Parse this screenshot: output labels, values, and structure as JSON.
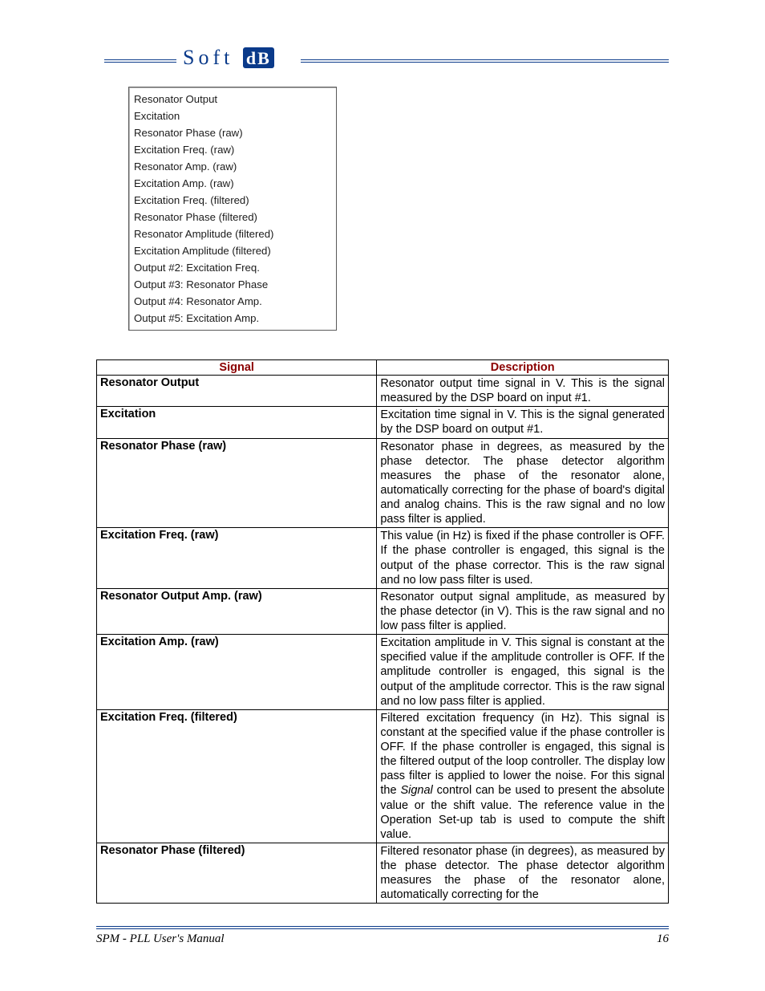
{
  "logo": {
    "left": "Soft",
    "right": "dB"
  },
  "listbox": [
    "Resonator Output",
    "Excitation",
    "Resonator Phase (raw)",
    "Excitation Freq. (raw)",
    "Resonator Amp. (raw)",
    "Excitation Amp. (raw)",
    "Excitation Freq. (filtered)",
    "Resonator Phase (filtered)",
    "Resonator Amplitude (filtered)",
    "Excitation Amplitude (filtered)",
    "Output #2: Excitation Freq.",
    "Output #3: Resonator Phase",
    "Output #4: Resonator Amp.",
    "Output #5: Excitation Amp."
  ],
  "table": {
    "headers": {
      "signal": "Signal",
      "description": "Description"
    },
    "rows": [
      {
        "signal": "Resonator Output",
        "desc": "Resonator output time signal in V. This is the signal measured by the DSP board on input #1."
      },
      {
        "signal": "Excitation",
        "desc": "Excitation time signal in V. This is the signal generated by the DSP board on output #1."
      },
      {
        "signal": "Resonator Phase (raw)",
        "desc": "Resonator phase in degrees, as measured by the phase detector. The phase detector algorithm measures the phase of the resonator alone, automatically correcting for the phase of board's digital and analog chains. This is the raw signal and no low pass filter is applied."
      },
      {
        "signal": "Excitation Freq. (raw)",
        "desc": "This value (in Hz) is fixed if the phase controller is OFF. If the phase controller is engaged, this signal is the output of the phase corrector. This is the raw signal and no low pass filter is used."
      },
      {
        "signal": "Resonator Output Amp. (raw)",
        "desc": "Resonator output signal amplitude, as measured by the phase detector (in V). This is the raw signal and no low pass filter is applied."
      },
      {
        "signal": "Excitation Amp. (raw)",
        "desc": "Excitation amplitude in V. This signal is constant at the specified value if the amplitude controller is OFF. If the amplitude controller is engaged, this signal is the output of the amplitude corrector. This is the raw signal and no low pass filter is applied."
      },
      {
        "signal": "Excitation Freq. (filtered)",
        "desc": "Filtered excitation frequency (in Hz). This signal is constant at the specified value if the phase controller is OFF. If the phase controller is engaged, this signal is the filtered output of the loop controller. The display low pass filter is applied to lower the noise. For this signal the <span class=\"italic\">Signal</span> control can be used to present the absolute value or the shift value. The reference value in the Operation Set-up tab is used to compute the shift value."
      },
      {
        "signal": "Resonator Phase (filtered)",
        "desc": "Filtered resonator phase (in degrees), as measured by the phase detector. The phase detector algorithm measures the phase of the resonator alone, automatically correcting for the"
      }
    ]
  },
  "footer": {
    "title": "SPM - PLL User's Manual",
    "page": "16"
  }
}
